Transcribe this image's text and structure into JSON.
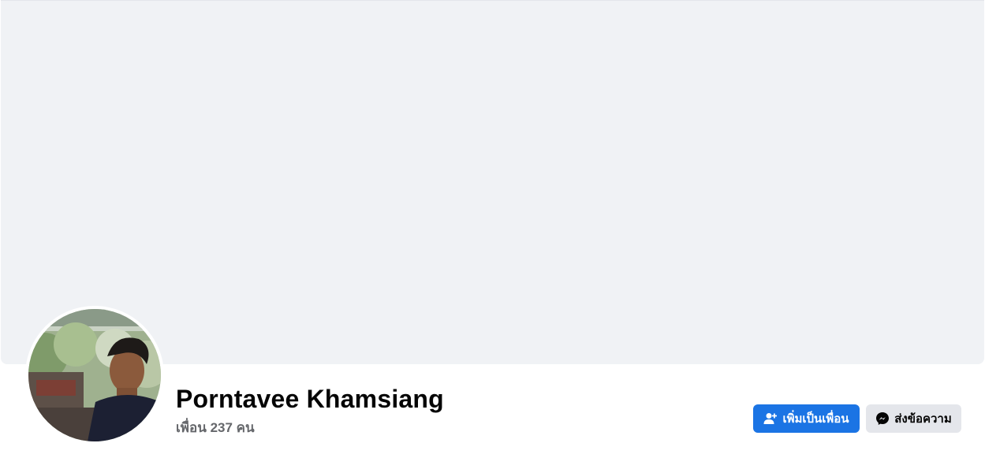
{
  "profile": {
    "name": "Porntavee Khamsiang",
    "friends_text": "เพื่อน 237 คน"
  },
  "actions": {
    "add_friend_label": "เพิ่มเป็นเพื่อน",
    "message_label": "ส่งข้อความ"
  },
  "icons": {
    "add_friend": "person-add-icon",
    "message": "messenger-icon"
  },
  "colors": {
    "cover_bg": "#f0f2f5",
    "primary_button": "#1b74e4",
    "secondary_button": "#e4e6eb",
    "name_text": "#050505",
    "secondary_text": "#65676b"
  }
}
